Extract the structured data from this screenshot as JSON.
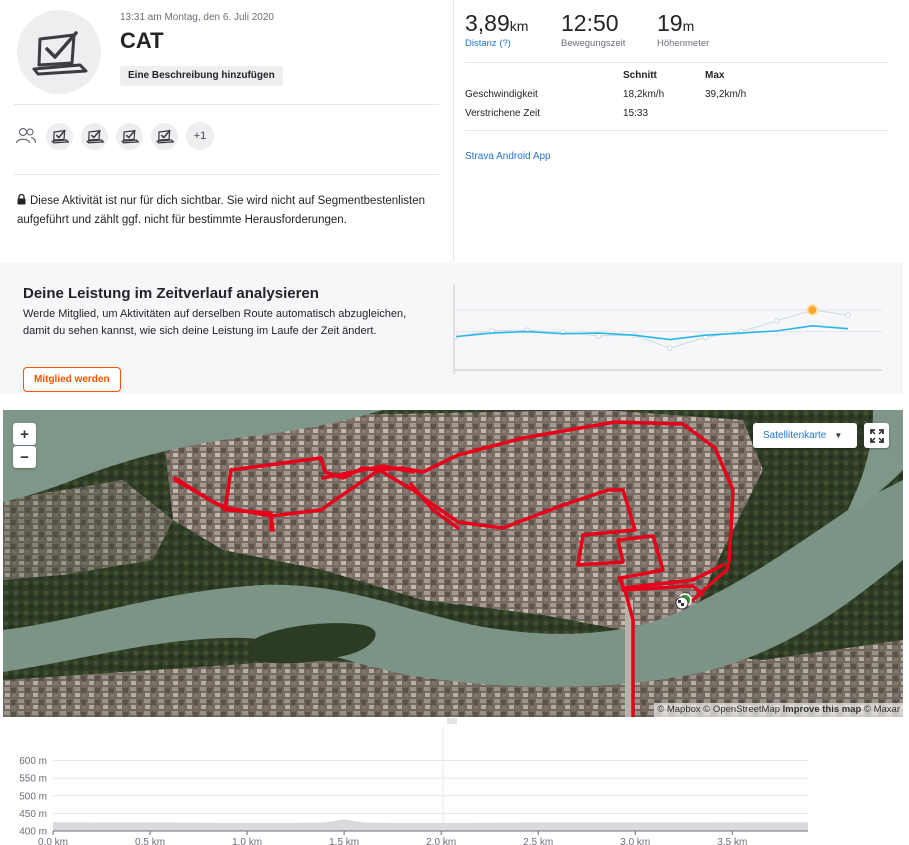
{
  "activity": {
    "date": "13:31 am Montag, den 6. Juli 2020",
    "title": "CAT",
    "add_description": "Eine Beschreibung hinzufügen",
    "extra_participants": "+1",
    "privacy_text": "Diese Aktivität ist nur für dich sichtbar. Sie wird nicht auf Segmentbestenlisten aufgeführt und zählt ggf. nicht für bestimmte Herausforderungen."
  },
  "stats": {
    "distance": {
      "value": "3,89",
      "unit": "km",
      "label": "Distanz (?)"
    },
    "moving_time": {
      "value": "12:50",
      "label": "Bewegungszeit"
    },
    "elevation": {
      "value": "19",
      "unit": "m",
      "label": "Höhenmeter"
    },
    "table": {
      "headers": [
        "",
        "Schnitt",
        "Max"
      ],
      "rows": [
        [
          "Geschwindigkeit",
          "18,2km/h",
          "39,2km/h"
        ],
        [
          "Verstrichene Zeit",
          "15:33",
          ""
        ]
      ]
    },
    "device": "Strava Android App"
  },
  "upsell": {
    "title": "Deine Leistung im Zeitverlauf analysieren",
    "text": "Werde Mitglied, um Aktivitäten auf derselben Route automatisch abzugleichen, damit du sehen kannst, wie sich deine Leistung im Laufe der Zeit ändert.",
    "button": "Mitglied werden"
  },
  "map": {
    "zoom_in": "+",
    "zoom_out": "−",
    "map_type": "Satellitenkarte",
    "attribution_prefix": "© Mapbox © OpenStreetMap ",
    "attribution_link": "Improve this map",
    "attribution_suffix": " © Maxar",
    "route_color": "#e6001a"
  },
  "colors": {
    "accent": "#fc5200",
    "link": "#1f75cb",
    "trend_line": "#29b6e8",
    "highlight_point": "#f4a92b"
  },
  "chart_data": [
    {
      "type": "line",
      "title": "",
      "series": [
        {
          "values": [
            0.38,
            0.46,
            0.47,
            0.44,
            0.39,
            0.4,
            0.22,
            0.37,
            0.45,
            0.6,
            0.75,
            0.68
          ]
        },
        {
          "values": [
            0.38,
            0.43,
            0.45,
            0.42,
            0.43,
            0.4,
            0.34,
            0.4,
            0.43,
            0.46,
            0.53,
            0.49
          ]
        }
      ],
      "highlight_index": 10,
      "grid": true
    },
    {
      "type": "area",
      "title": "",
      "xlabel": "",
      "ylabel": "",
      "x_ticks": [
        "0.0 km",
        "0.5 km",
        "1.0 km",
        "1.5 km",
        "2.0 km",
        "2.5 km",
        "3.0 km",
        "3.5 km"
      ],
      "y_ticks": [
        "400 m",
        "450 m",
        "500 m",
        "550 m",
        "600 m"
      ],
      "ylim": [
        400,
        610
      ],
      "xlim": [
        0,
        3.89
      ],
      "x": [
        0,
        0.3,
        0.6,
        0.9,
        1.2,
        1.4,
        1.5,
        1.6,
        1.8,
        2.1,
        2.4,
        2.7,
        3.0,
        3.3,
        3.6,
        3.89
      ],
      "y": [
        425,
        424,
        424,
        423,
        423,
        424,
        433,
        424,
        423,
        423,
        424,
        424,
        424,
        424,
        425,
        425
      ]
    }
  ]
}
